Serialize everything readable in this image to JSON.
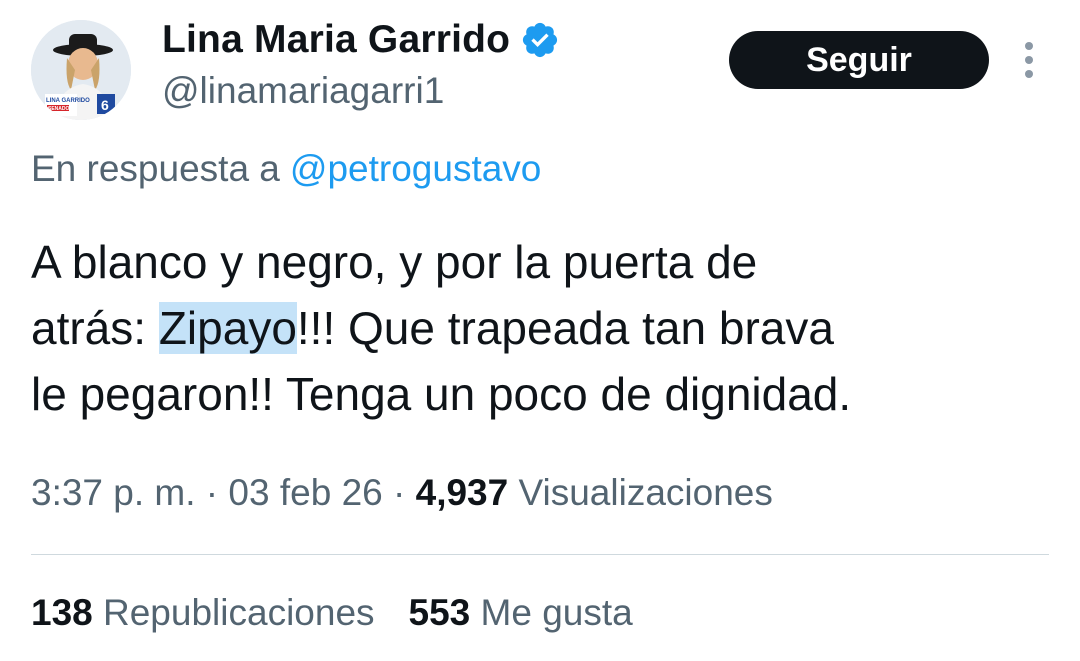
{
  "author": {
    "name": "Lina Maria Garrido",
    "handle": "@linamariagarri1",
    "avatar_text": {
      "name": "LINA GARRIDO",
      "role": "SENADO",
      "number": "6"
    }
  },
  "follow_button": {
    "label": "Seguir"
  },
  "reply": {
    "prefix": "En respuesta a",
    "mention": "@petrogustavo"
  },
  "tweet": {
    "line1": "A blanco y negro, y por la puerta de",
    "line2_pre": "atrás: ",
    "line2_highlight": "Zipayo",
    "line2_post": "!!!  Que trapeada tan brava",
    "line3": "le pegaron!! Tenga un poco de dignidad."
  },
  "meta": {
    "time": "3:37 p. m.",
    "sep1": " · ",
    "date": "03 feb 26",
    "sep2": " · ",
    "views_count": "4,937",
    "views_label": " Visualizaciones"
  },
  "stats": {
    "reposts_count": "138",
    "reposts_label": " Republicaciones",
    "likes_count": "553",
    "likes_label": " Me gusta"
  },
  "colors": {
    "text": "#0f1419",
    "secondary": "#536471",
    "link": "#1d9bf0",
    "highlight": "#c4e2f8",
    "verified": "#1d9bf0",
    "button_bg": "#0f1419"
  },
  "icons": [
    "verified-badge-icon",
    "more-options-icon"
  ]
}
